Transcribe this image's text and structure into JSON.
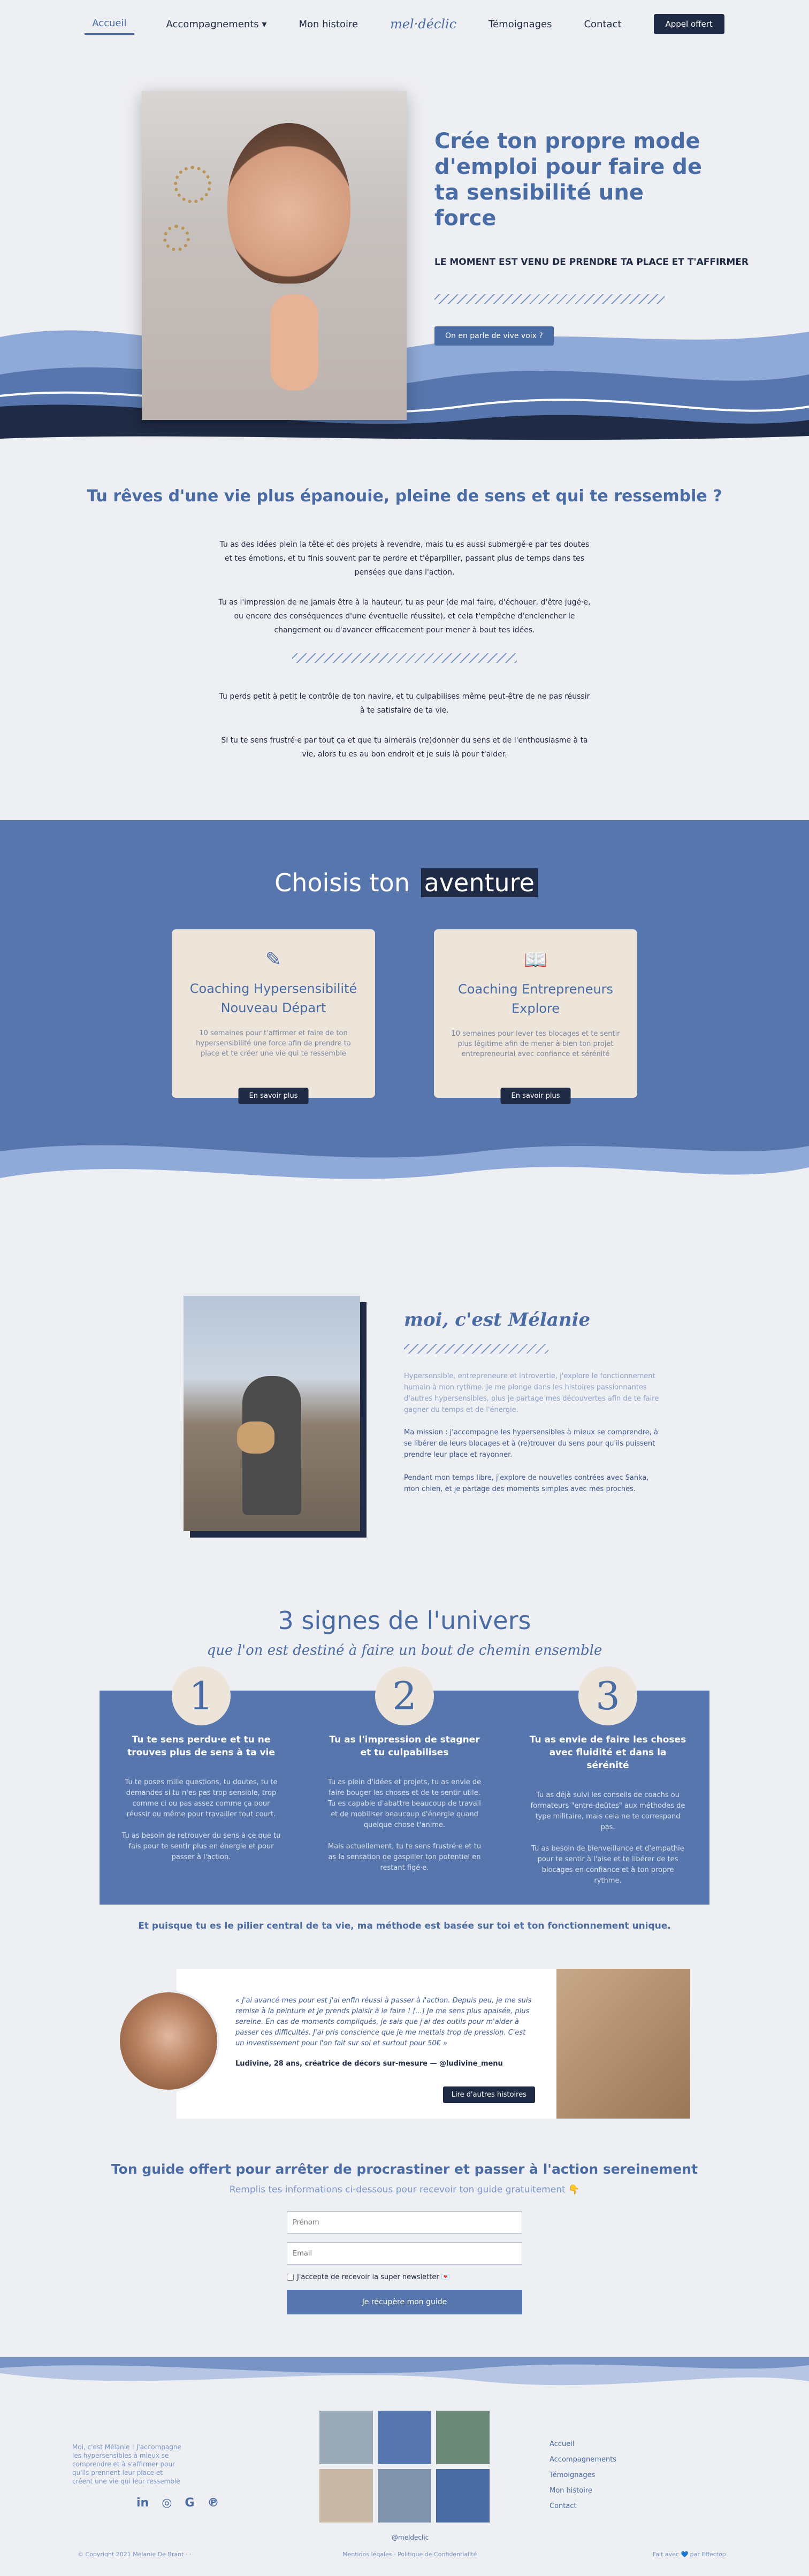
{
  "nav": {
    "items": [
      "Accueil",
      "Accompagnements",
      "Mon histoire",
      "Témoignages",
      "Contact"
    ],
    "logo": "mel·déclic",
    "cta": "Appel offert"
  },
  "hero": {
    "title": "Crée ton propre mode d'emploi pour faire de ta sensibilité une force",
    "subtitle": "LE MOMENT EST VENU DE PRENDRE TA PLACE ET T'AFFIRMER",
    "button": "On en parle de vive voix ?"
  },
  "dreams": {
    "title": "Tu rêves d'une vie plus épanouie, pleine de sens et qui te ressemble ?",
    "p1": "Tu as des idées plein la tête et des projets à revendre, mais tu es aussi submergé·e par tes doutes et tes émotions, et tu finis souvent par te perdre et t'éparpiller, passant plus de temps dans tes pensées que dans l'action.",
    "p2": "Tu as l'impression de ne jamais être à la hauteur, tu as peur (de mal faire, d'échouer, d'être jugé·e, ou encore des conséquences d'une éventuelle réussite), et cela t'empêche d'enclencher le changement ou d'avancer efficacement pour mener à bout tes idées.",
    "p3": "Tu perds petit à petit le contrôle de ton navire, et tu culpabilises même peut-être de ne pas réussir à te satisfaire de ta vie.",
    "p4": "Si tu te sens frustré·e par tout ça et que tu aimerais (re)donner du sens et de l'enthousiasme à ta vie, alors tu es au bon endroit et je suis là pour t'aider."
  },
  "adventure": {
    "title_a": "Choisis ton",
    "title_b": "aventure",
    "cards": [
      {
        "icon": "pencil-icon",
        "title": "Coaching Hypersensibilité Nouveau Départ",
        "text": "10 semaines pour t'affirmer et faire de ton hypersensibilité une force afin de prendre ta place et te créer une vie qui te ressemble",
        "button": "En savoir plus"
      },
      {
        "icon": "book-icon",
        "title": "Coaching Entrepreneurs Explore",
        "text": "10 semaines pour lever tes blocages et te sentir plus légitime afin de mener à bien ton projet entrepreneurial avec confiance et sérénité",
        "button": "En savoir plus"
      }
    ]
  },
  "me": {
    "title": "moi, c'est Mélanie",
    "p1": "Hypersensible, entrepreneure et introvertie, j'explore le fonctionnement humain à mon rythme. Je me plonge dans les histoires passionnantes d'autres hypersensibles, plus je partage mes découvertes afin de te faire gagner du temps et de l'énergie.",
    "p2": "Ma mission : j'accompagne les hypersensibles à mieux se comprendre, à se libérer de leurs blocages et à (re)trouver du sens pour qu'ils puissent prendre leur place et rayonner.",
    "p3": "Pendant mon temps libre, j'explore de nouvelles contrées avec Sanka, mon chien, et je partage des moments simples avec mes proches."
  },
  "signs": {
    "title": "3 signes de l'univers",
    "subtitle": "que l'on est destiné à faire un bout de chemin ensemble",
    "items": [
      {
        "num": "1",
        "title": "Tu te sens perdu·e et tu ne trouves plus de sens à ta vie",
        "p1": "Tu te poses mille questions, tu doutes, tu te demandes si tu n'es pas trop sensible, trop comme ci ou pas assez comme ça pour réussir ou même pour travailler tout court.",
        "p2": "Tu as besoin de retrouver du sens à ce que tu fais pour te sentir plus en énergie et pour passer à l'action."
      },
      {
        "num": "2",
        "title": "Tu as l'impression de stagner et tu culpabilises",
        "p1": "Tu as plein d'idées et projets, tu as envie de faire bouger les choses et de te sentir utile. Tu es capable d'abattre beaucoup de travail et de mobiliser beaucoup d'énergie quand quelque chose t'anime.",
        "p2": "Mais actuellement, tu te sens frustré·e et tu as la sensation de gaspiller ton potentiel en restant figé·e."
      },
      {
        "num": "3",
        "title": "Tu as envie de faire les choses avec fluidité et dans la sérénité",
        "p1": "Tu as déjà suivi les conseils de coachs ou formateurs \"entre-deûtes\" aux méthodes de type militaire, mais cela ne te correspond pas.",
        "p2": "Tu as besoin de bienveillance et d'empathie pour te sentir à l'aise et te libérer de tes blocages en confiance et à ton propre rythme."
      }
    ],
    "tagline": "Et puisque tu es le pilier central de ta vie, ma méthode est basée sur toi et ton fonctionnement unique."
  },
  "testimonial": {
    "quote": "« J'ai avancé mes pour est j'ai enfin réussi à passer à l'action. Depuis peu, je me suis remise à la peinture et je prends plaisir à le faire ! [...] Je me sens plus apaisée, plus sereine. En cas de moments compliqués, je sais que j'ai des outils pour m'aider à passer ces difficultés. J'ai pris conscience que je me mettais trop de pression. C'est un investissement pour l'on fait sur soi et surtout pour 50€ »",
    "author": "Ludivine, 28 ans, créatrice de décors sur-mesure — @ludivine_menu",
    "button": "Lire d'autres histoires"
  },
  "guide": {
    "title": "Ton guide offert pour arrêter de procrastiner et passer à l'action sereinement",
    "subtitle": "Remplis tes informations ci-dessous pour recevoir ton guide gratuitement 👇",
    "first_placeholder": "Prénom",
    "email_placeholder": "Email",
    "consent": "J'accepte de recevoir la super newsletter 💌",
    "submit": "Je récupère mon guide"
  },
  "footer": {
    "desc": "Moi, c'est Mélanie ! J'accompagne les hypersensibles à mieux se comprendre et à s'affirmer pour qu'ils prennent leur place et créent une vie qui leur ressemble",
    "social": [
      "in",
      "◎",
      "G",
      "℗"
    ],
    "grid_label": "@meldeclic",
    "menu": [
      "Accueil",
      "Accompagnements",
      "Témoignages",
      "Mon histoire",
      "Contact"
    ],
    "copyright": "© Copyright 2021 Mélanie De Brant · ·",
    "legal": "Mentions légales · Politique de Confidentialité",
    "made": "Fait avec 💙 par Effectop"
  }
}
